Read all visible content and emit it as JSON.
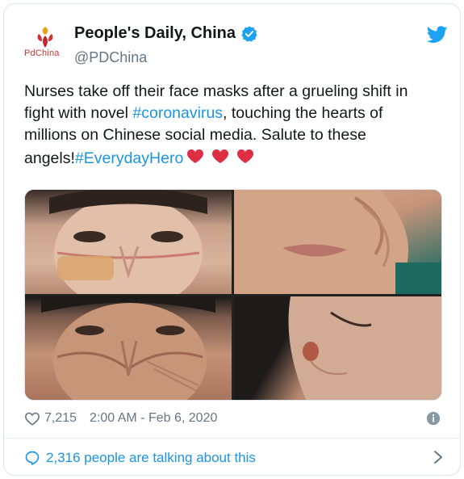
{
  "tweet": {
    "author": {
      "display_name": "People's Daily, China",
      "handle": "@PDChina",
      "logo_text": "PdChina",
      "verified": true
    },
    "text_parts": [
      "Nurses take off their face masks after a grueling shift in fight with novel ",
      "#coronavirus",
      ", touching the hearts of millions on Chinese social media. Salute to these angels!",
      "#EverydayHero"
    ],
    "heart_emojis": 3,
    "media_photos": 4,
    "likes": "7,215",
    "timestamp": "2:00 AM - Feb 6, 2020",
    "talking": "2,316 people are talking about this"
  },
  "icons": {
    "verified": "verified-badge-icon",
    "platform": "twitter-bird-icon",
    "like": "heart-outline-icon",
    "info": "info-icon",
    "comment": "speech-bubble-icon",
    "chevron": "chevron-right-icon"
  },
  "colors": {
    "link": "#1b95e0",
    "secondary_text": "#657786",
    "brand_red": "#c4262d",
    "heart": "#e0245e"
  }
}
